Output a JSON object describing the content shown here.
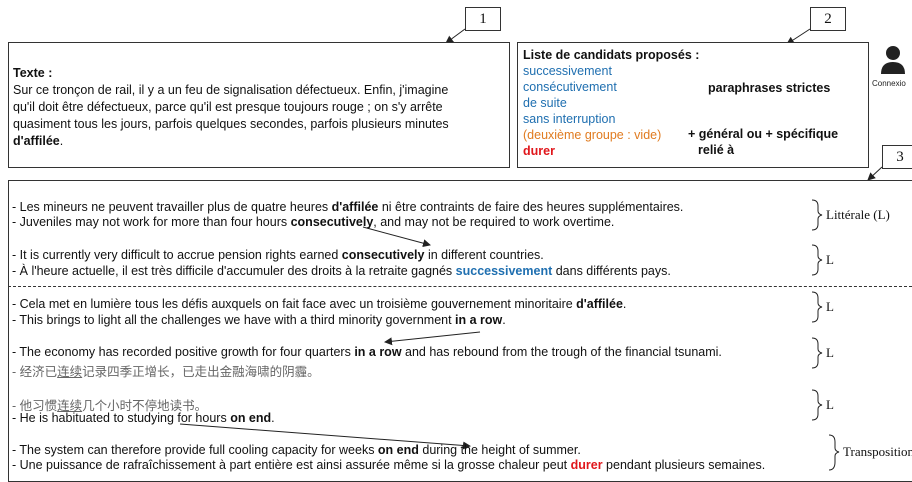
{
  "callouts": [
    "1",
    "2",
    "3"
  ],
  "texte": {
    "title": "Texte :",
    "lines": [
      "Sur ce tronçon de rail, il y a un feu de signalisation défectueux. Enfin, j'imagine",
      "qu'il doit être défectueux, parce qu'il est presque toujours rouge ; on s'y arrête",
      "quasiment tous les jours, parfois quelques secondes, parfois plusieurs minutes"
    ],
    "last_bold": "d'affilée",
    "last_rest": "."
  },
  "candidates": {
    "title": "Liste de candidats proposés :",
    "blue_items": [
      "successivement",
      "consécutivement",
      "de suite",
      "sans interruption"
    ],
    "orange_item": "(deuxième groupe : vide)",
    "red_item": "durer",
    "strict_label": "paraphrases strictes",
    "general_label_1": "+ général ou + spécifique",
    "general_label_2": "relié à"
  },
  "user": {
    "label": "Connexio"
  },
  "examples": {
    "l1a_pre": "- Les mineurs ne peuvent travailler plus de quatre heures ",
    "l1a_bold": "d'affilée",
    "l1a_post": " ni être contraints de faire des heures supplémentaires.",
    "l1b_pre": "- Juveniles may not work for more than four hours ",
    "l1b_bold": "consecutively",
    "l1b_post": ", and may not be required to work overtime.",
    "l2a_pre": "- It is currently very difficult to accrue pension rights earned ",
    "l2a_bold": "consecutively",
    "l2a_post": " in different countries.",
    "l2b_pre": "- À l'heure actuelle, il est très difficile d'accumuler des droits à la retraite gagnés ",
    "l2b_blue": "successivement",
    "l2b_post": " dans différents pays.",
    "l3a_pre": "- Cela met en lumière tous les défis auxquels on fait face avec un troisième gouvernement minoritaire ",
    "l3a_bold": "d'affilée",
    "l3a_post": ".",
    "l3b_pre": "- This brings to light all the challenges we have with a third minority government ",
    "l3b_bold": "in a row",
    "l3b_post": ".",
    "l4a_pre": "- The economy has recorded positive growth for four quarters ",
    "l4a_bold": "in a row",
    "l4a_post": " and has rebound from the trough of the financial tsunami.",
    "l4b_pre": "- 经济已",
    "l4b_u": "连续",
    "l4b_post": "记录四季正增长，已走出金融海啸的阴霾。",
    "l5a_pre": "- 他习惯",
    "l5a_u": "连续",
    "l5a_post": "几个小时不停地读书。",
    "l5b_pre": "- He is habituated to studying for hours ",
    "l5b_bold": "on end",
    "l5b_post": ".",
    "l6a_pre": "- The system can therefore provide full cooling capacity for weeks ",
    "l6a_bold": "on end",
    "l6a_post": " during the height of summer.",
    "l6b_pre": "- Une puissance de rafraîchissement à part entière est ainsi assurée même si la grosse chaleur peut ",
    "l6b_red": "durer",
    "l6b_post": " pendant plusieurs semaines."
  },
  "labels": {
    "litterale": "Littérale (L)",
    "l": "L",
    "transposition": "Transposition"
  },
  "colors": {
    "blue": "#1f6fb0",
    "orange": "#e07b20",
    "red": "#e0161b"
  }
}
